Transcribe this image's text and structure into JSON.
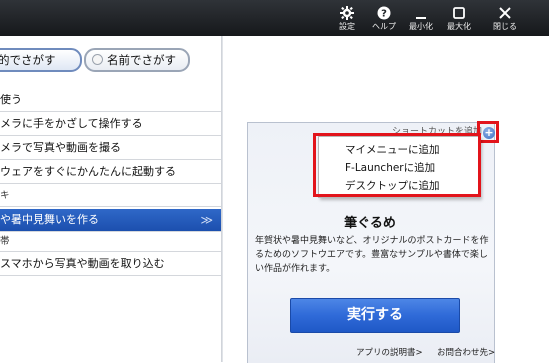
{
  "titlebar": {
    "settings_label": "設定",
    "help_label": "ヘルプ",
    "minimize_label": "最小化",
    "maximize_label": "最大化",
    "close_label": "閉じる"
  },
  "search_tabs": {
    "purpose_label": "的でさがす",
    "name_label": "名前でさがす"
  },
  "list": {
    "items": [
      {
        "label": "使う"
      },
      {
        "label": "メラに手をかざして操作する"
      },
      {
        "label": "メラで写真や動画を撮る"
      },
      {
        "label": "ウェアをすぐにかんたんに起動する"
      },
      {
        "label": "キ"
      },
      {
        "label": "や暑中見舞いを作る",
        "selected": true,
        "chevron": "≫"
      },
      {
        "label": "帯"
      },
      {
        "label": "スマホから写真や動画を取り込む"
      }
    ]
  },
  "card": {
    "top_text": "ショートカットを追加",
    "plus_icon": "+",
    "menu": {
      "items": [
        {
          "label": "マイメニューに追加"
        },
        {
          "label": "F-Launcherに追加"
        },
        {
          "label": "デスクトップに追加"
        }
      ]
    },
    "app_name": "筆ぐるめ",
    "description": "年賀状や暑中見舞いなど、オリジナルのポストカードを作るためのソフトウエアです。豊富なサンプルや書体で楽しい作品が作れます。",
    "run_label": "実行する",
    "manual_link": "アプリの説明書>",
    "contact_link": "お問合わせ先>"
  },
  "colors": {
    "titlebar": "#1e2124",
    "selected_row": "#2559bd",
    "run_button": "#2f6ad8",
    "highlight": "#e2141b"
  }
}
